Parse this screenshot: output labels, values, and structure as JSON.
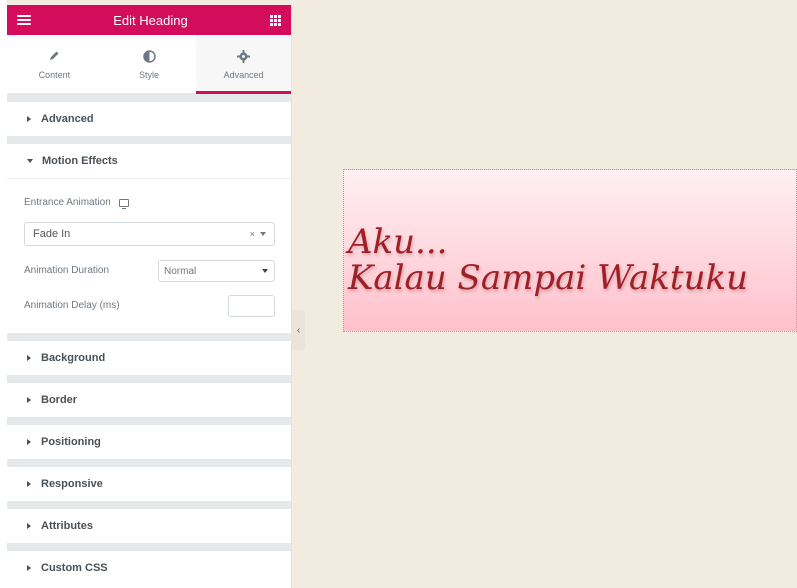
{
  "header": {
    "title": "Edit Heading"
  },
  "tabs": [
    {
      "label": "Content",
      "icon": "pencil-icon"
    },
    {
      "label": "Style",
      "icon": "half-circle-icon"
    },
    {
      "label": "Advanced",
      "icon": "gear-icon",
      "active": true
    }
  ],
  "sections": {
    "advanced": "Advanced",
    "motion_effects": "Motion Effects",
    "background": "Background",
    "border": "Border",
    "positioning": "Positioning",
    "responsive": "Responsive",
    "attributes": "Attributes",
    "custom_css": "Custom CSS"
  },
  "motion": {
    "entrance_label": "Entrance Animation",
    "entrance_value": "Fade In",
    "clear_glyph": "×",
    "duration_label": "Animation Duration",
    "duration_value": "Normal",
    "delay_label": "Animation Delay (ms)",
    "delay_value": ""
  },
  "canvas": {
    "line1": "Aku...",
    "line2": "Kalau Sampai Waktuku"
  },
  "colors": {
    "accent": "#d30c5c",
    "heading_text": "#9e1f25",
    "canvas_bg": "#f2ebe0"
  }
}
